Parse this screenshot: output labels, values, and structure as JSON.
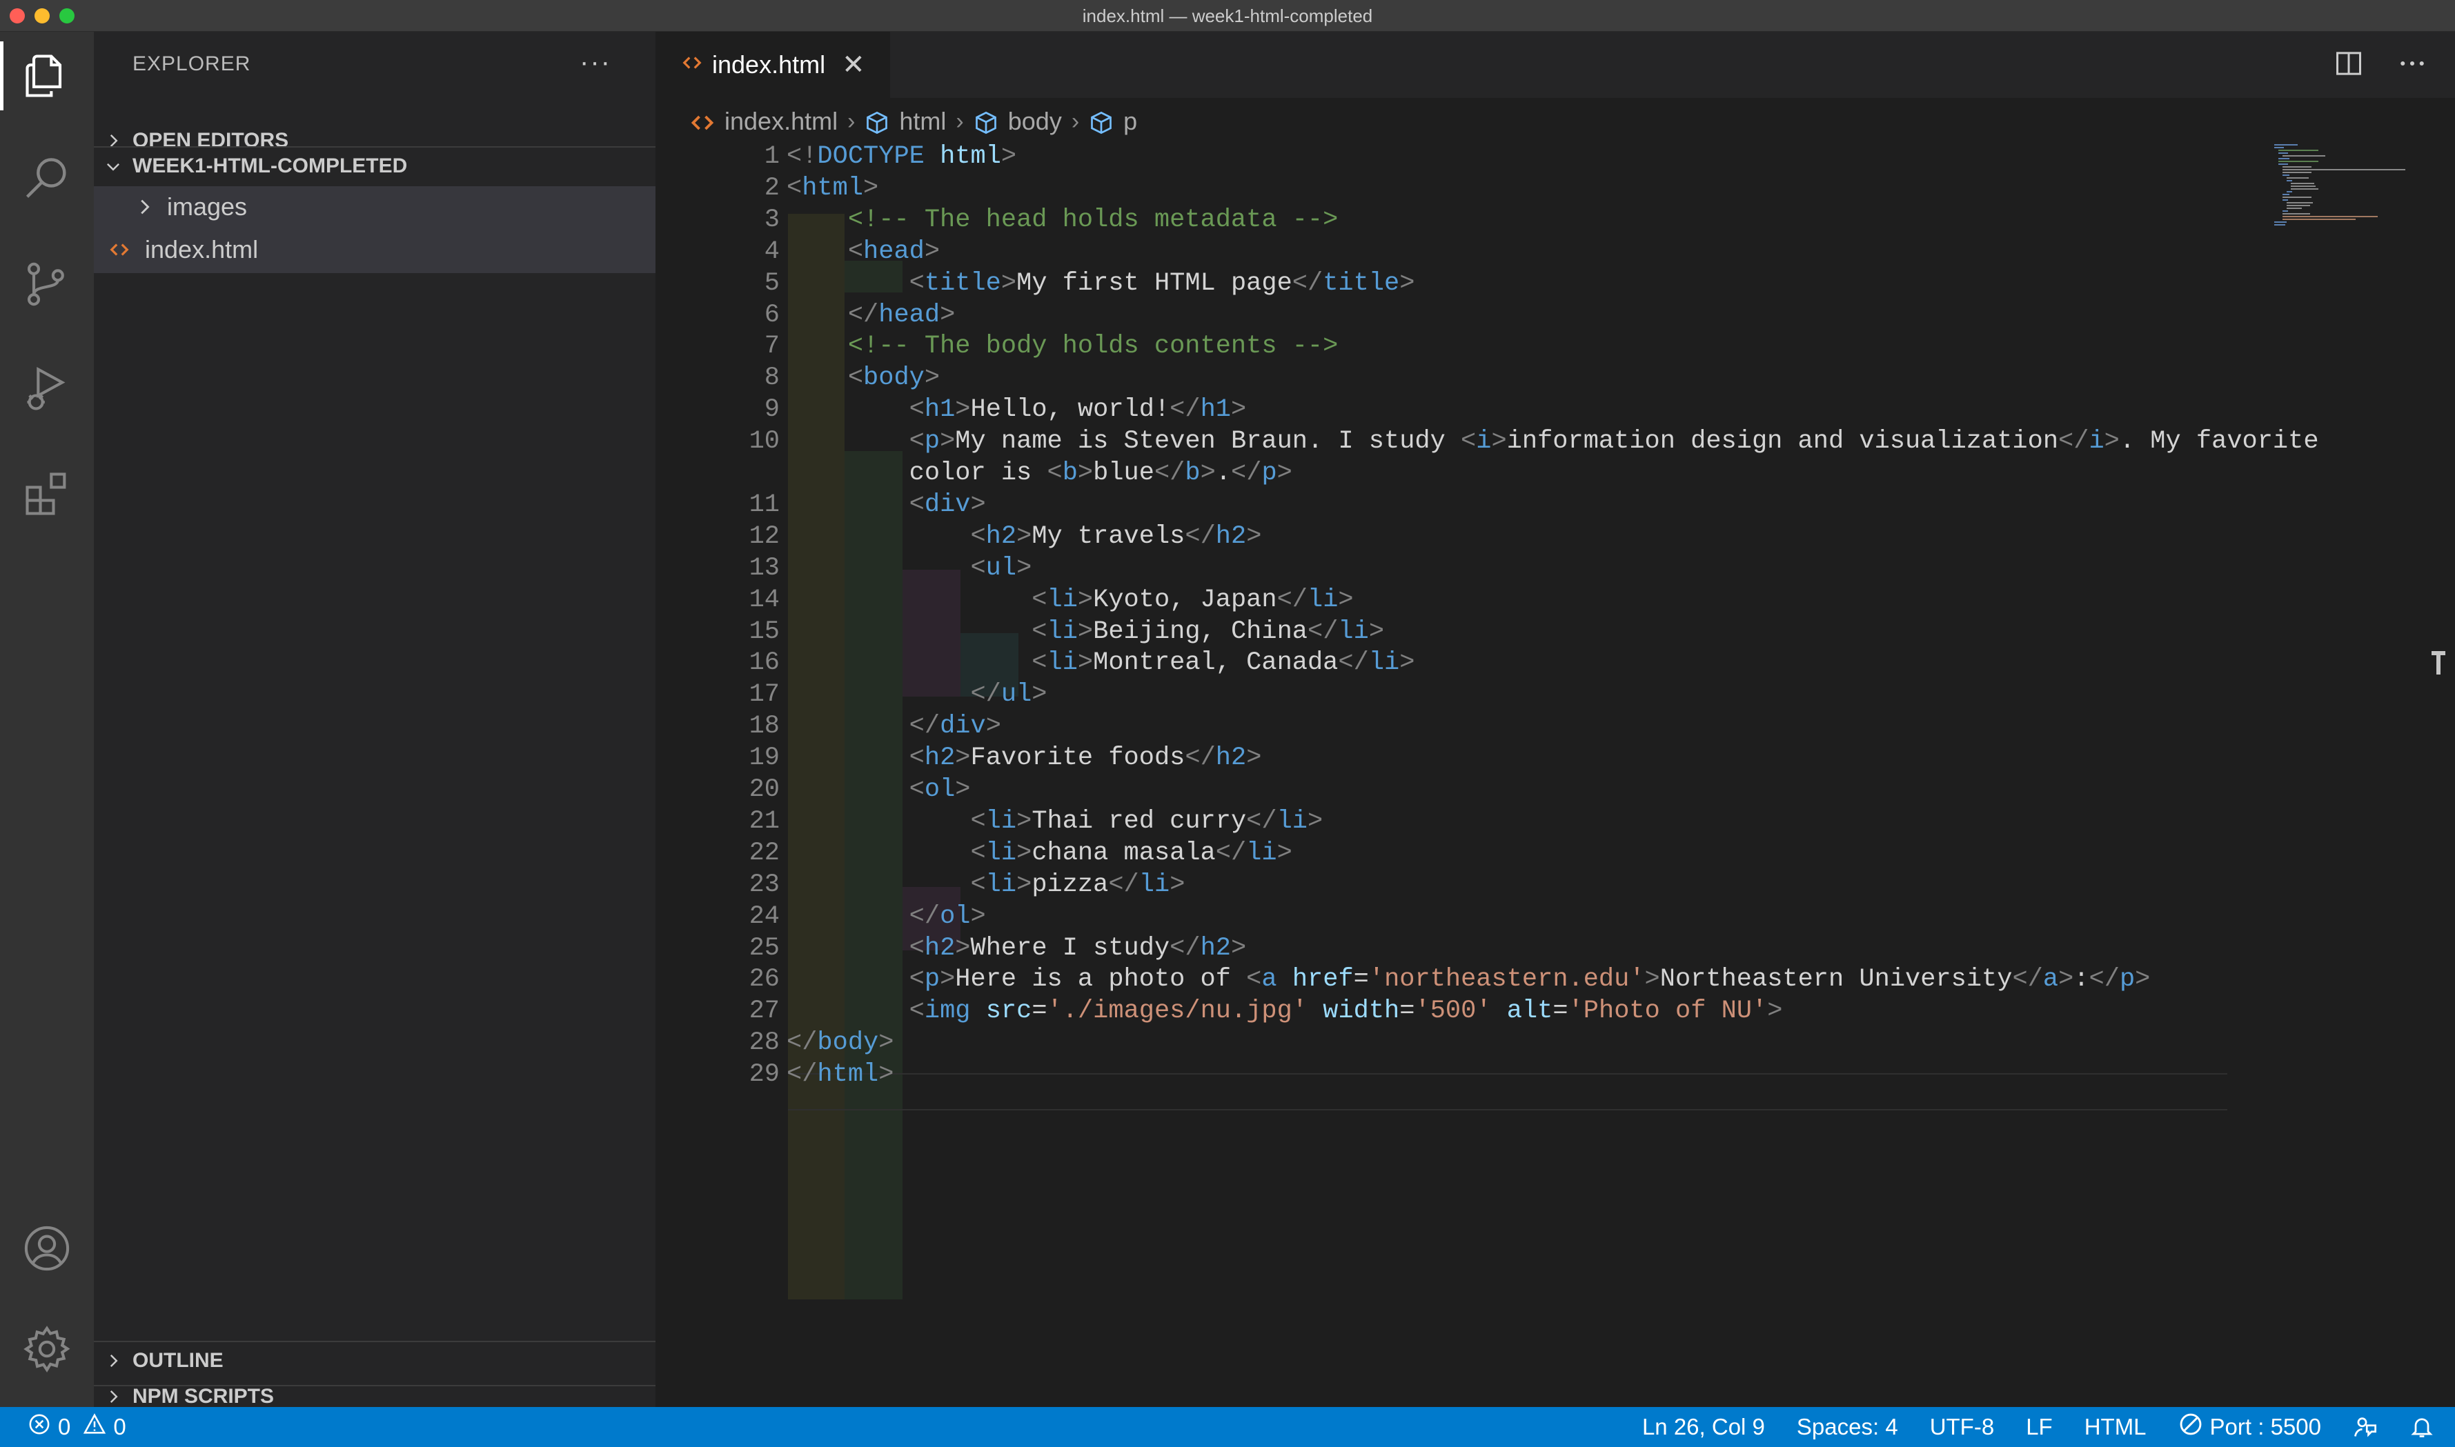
{
  "window": {
    "title": "index.html — week1-html-completed"
  },
  "activity_bar": {
    "items": [
      "explorer-icon",
      "search-icon",
      "source-control-icon",
      "run-debug-icon",
      "extensions-icon",
      "account-icon",
      "settings-gear-icon"
    ]
  },
  "sidebar": {
    "title": "EXPLORER",
    "more": "···",
    "sections": {
      "open_editors": "OPEN EDITORS",
      "workspace": "WEEK1-HTML-COMPLETED",
      "outline": "OUTLINE",
      "npm_scripts": "NPM SCRIPTS"
    },
    "tree": [
      {
        "label": "images",
        "type": "folder"
      },
      {
        "label": "index.html",
        "type": "file"
      }
    ]
  },
  "editor": {
    "tab": {
      "label": "index.html",
      "close": "✕"
    },
    "breadcrumbs": [
      "index.html",
      "html",
      "body",
      "p"
    ],
    "line_numbers": [
      "1",
      "2",
      "3",
      "4",
      "5",
      "6",
      "7",
      "8",
      "9",
      "10",
      "",
      "11",
      "12",
      "13",
      "14",
      "15",
      "16",
      "17",
      "18",
      "19",
      "20",
      "21",
      "22",
      "23",
      "24",
      "25",
      "26",
      "27",
      "28",
      "29"
    ],
    "lines": [
      [
        [
          "p",
          "<!"
        ],
        [
          "t",
          "DOCTYPE"
        ],
        [
          "x",
          " "
        ],
        [
          "a",
          "html"
        ],
        [
          "p",
          ">"
        ]
      ],
      [
        [
          "p",
          "<"
        ],
        [
          "t",
          "html"
        ],
        [
          "p",
          ">"
        ]
      ],
      [
        [
          "x",
          "    "
        ],
        [
          "c",
          "<!-- The head holds metadata -->"
        ]
      ],
      [
        [
          "x",
          "    "
        ],
        [
          "p",
          "<"
        ],
        [
          "t",
          "head"
        ],
        [
          "p",
          ">"
        ]
      ],
      [
        [
          "x",
          "        "
        ],
        [
          "p",
          "<"
        ],
        [
          "t",
          "title"
        ],
        [
          "p",
          ">"
        ],
        [
          "x",
          "My first HTML page"
        ],
        [
          "p",
          "</"
        ],
        [
          "t",
          "title"
        ],
        [
          "p",
          ">"
        ]
      ],
      [
        [
          "x",
          "    "
        ],
        [
          "p",
          "</"
        ],
        [
          "t",
          "head"
        ],
        [
          "p",
          ">"
        ]
      ],
      [
        [
          "x",
          "    "
        ],
        [
          "c",
          "<!-- The body holds contents -->"
        ]
      ],
      [
        [
          "x",
          "    "
        ],
        [
          "p",
          "<"
        ],
        [
          "t",
          "body"
        ],
        [
          "p",
          ">"
        ]
      ],
      [
        [
          "x",
          "        "
        ],
        [
          "p",
          "<"
        ],
        [
          "t",
          "h1"
        ],
        [
          "p",
          ">"
        ],
        [
          "x",
          "Hello, world!"
        ],
        [
          "p",
          "</"
        ],
        [
          "t",
          "h1"
        ],
        [
          "p",
          ">"
        ]
      ],
      [
        [
          "x",
          "        "
        ],
        [
          "p",
          "<"
        ],
        [
          "t",
          "p"
        ],
        [
          "p",
          ">"
        ],
        [
          "x",
          "My name is Steven Braun. I study "
        ],
        [
          "p",
          "<"
        ],
        [
          "t",
          "i"
        ],
        [
          "p",
          ">"
        ],
        [
          "x",
          "information design and visualization"
        ],
        [
          "p",
          "</"
        ],
        [
          "t",
          "i"
        ],
        [
          "p",
          ">"
        ],
        [
          "x",
          ". My favorite"
        ]
      ],
      [
        [
          "x",
          "        color is "
        ],
        [
          "p",
          "<"
        ],
        [
          "t",
          "b"
        ],
        [
          "p",
          ">"
        ],
        [
          "x",
          "blue"
        ],
        [
          "p",
          "</"
        ],
        [
          "t",
          "b"
        ],
        [
          "p",
          ">"
        ],
        [
          "x",
          "."
        ],
        [
          "p",
          "</"
        ],
        [
          "t",
          "p"
        ],
        [
          "p",
          ">"
        ]
      ],
      [
        [
          "x",
          "        "
        ],
        [
          "p",
          "<"
        ],
        [
          "t",
          "div"
        ],
        [
          "p",
          ">"
        ]
      ],
      [
        [
          "x",
          "            "
        ],
        [
          "p",
          "<"
        ],
        [
          "t",
          "h2"
        ],
        [
          "p",
          ">"
        ],
        [
          "x",
          "My travels"
        ],
        [
          "p",
          "</"
        ],
        [
          "t",
          "h2"
        ],
        [
          "p",
          ">"
        ]
      ],
      [
        [
          "x",
          "            "
        ],
        [
          "p",
          "<"
        ],
        [
          "t",
          "ul"
        ],
        [
          "p",
          ">"
        ]
      ],
      [
        [
          "x",
          "                "
        ],
        [
          "p",
          "<"
        ],
        [
          "t",
          "li"
        ],
        [
          "p",
          ">"
        ],
        [
          "x",
          "Kyoto, Japan"
        ],
        [
          "p",
          "</"
        ],
        [
          "t",
          "li"
        ],
        [
          "p",
          ">"
        ]
      ],
      [
        [
          "x",
          "                "
        ],
        [
          "p",
          "<"
        ],
        [
          "t",
          "li"
        ],
        [
          "p",
          ">"
        ],
        [
          "x",
          "Beijing, China"
        ],
        [
          "p",
          "</"
        ],
        [
          "t",
          "li"
        ],
        [
          "p",
          ">"
        ]
      ],
      [
        [
          "x",
          "                "
        ],
        [
          "p",
          "<"
        ],
        [
          "t",
          "li"
        ],
        [
          "p",
          ">"
        ],
        [
          "x",
          "Montreal, Canada"
        ],
        [
          "p",
          "</"
        ],
        [
          "t",
          "li"
        ],
        [
          "p",
          ">"
        ]
      ],
      [
        [
          "x",
          "            "
        ],
        [
          "p",
          "</"
        ],
        [
          "t",
          "ul"
        ],
        [
          "p",
          ">"
        ]
      ],
      [
        [
          "x",
          "        "
        ],
        [
          "p",
          "</"
        ],
        [
          "t",
          "div"
        ],
        [
          "p",
          ">"
        ]
      ],
      [
        [
          "x",
          "        "
        ],
        [
          "p",
          "<"
        ],
        [
          "t",
          "h2"
        ],
        [
          "p",
          ">"
        ],
        [
          "x",
          "Favorite foods"
        ],
        [
          "p",
          "</"
        ],
        [
          "t",
          "h2"
        ],
        [
          "p",
          ">"
        ]
      ],
      [
        [
          "x",
          "        "
        ],
        [
          "p",
          "<"
        ],
        [
          "t",
          "ol"
        ],
        [
          "p",
          ">"
        ]
      ],
      [
        [
          "x",
          "            "
        ],
        [
          "p",
          "<"
        ],
        [
          "t",
          "li"
        ],
        [
          "p",
          ">"
        ],
        [
          "x",
          "Thai red curry"
        ],
        [
          "p",
          "</"
        ],
        [
          "t",
          "li"
        ],
        [
          "p",
          ">"
        ]
      ],
      [
        [
          "x",
          "            "
        ],
        [
          "p",
          "<"
        ],
        [
          "t",
          "li"
        ],
        [
          "p",
          ">"
        ],
        [
          "x",
          "chana masala"
        ],
        [
          "p",
          "</"
        ],
        [
          "t",
          "li"
        ],
        [
          "p",
          ">"
        ]
      ],
      [
        [
          "x",
          "            "
        ],
        [
          "p",
          "<"
        ],
        [
          "t",
          "li"
        ],
        [
          "p",
          ">"
        ],
        [
          "x",
          "pizza"
        ],
        [
          "p",
          "</"
        ],
        [
          "t",
          "li"
        ],
        [
          "p",
          ">"
        ]
      ],
      [
        [
          "x",
          "        "
        ],
        [
          "p",
          "</"
        ],
        [
          "t",
          "ol"
        ],
        [
          "p",
          ">"
        ]
      ],
      [
        [
          "x",
          "        "
        ],
        [
          "p",
          "<"
        ],
        [
          "t",
          "h2"
        ],
        [
          "p",
          ">"
        ],
        [
          "x",
          "Where I study"
        ],
        [
          "p",
          "</"
        ],
        [
          "t",
          "h2"
        ],
        [
          "p",
          ">"
        ]
      ],
      [
        [
          "x",
          "        "
        ],
        [
          "p",
          "<"
        ],
        [
          "t",
          "p"
        ],
        [
          "p",
          ">"
        ],
        [
          "x",
          "Here is a photo of "
        ],
        [
          "p",
          "<"
        ],
        [
          "t",
          "a"
        ],
        [
          "x",
          " "
        ],
        [
          "a",
          "href"
        ],
        [
          "x",
          "="
        ],
        [
          "s",
          "'northeastern.edu'"
        ],
        [
          "p",
          ">"
        ],
        [
          "x",
          "Northeastern University"
        ],
        [
          "p",
          "</"
        ],
        [
          "t",
          "a"
        ],
        [
          "p",
          ">"
        ],
        [
          "x",
          ":"
        ],
        [
          "p",
          "</"
        ],
        [
          "t",
          "p"
        ],
        [
          "p",
          ">"
        ]
      ],
      [
        [
          "x",
          "        "
        ],
        [
          "p",
          "<"
        ],
        [
          "t",
          "img"
        ],
        [
          "x",
          " "
        ],
        [
          "a",
          "src"
        ],
        [
          "x",
          "="
        ],
        [
          "s",
          "'./images/nu.jpg'"
        ],
        [
          "x",
          " "
        ],
        [
          "a",
          "width"
        ],
        [
          "x",
          "="
        ],
        [
          "s",
          "'500'"
        ],
        [
          "x",
          " "
        ],
        [
          "a",
          "alt"
        ],
        [
          "x",
          "="
        ],
        [
          "s",
          "'Photo of NU'"
        ],
        [
          "p",
          ">"
        ]
      ],
      [
        [
          "p",
          "</"
        ],
        [
          "t",
          "body"
        ],
        [
          "p",
          ">"
        ]
      ],
      [
        [
          "p",
          "</"
        ],
        [
          "t",
          "html"
        ],
        [
          "p",
          ">"
        ]
      ]
    ]
  },
  "status_bar": {
    "errors": "0",
    "warnings": "0",
    "cursor": "Ln 26, Col 9",
    "spaces": "Spaces: 4",
    "encoding": "UTF-8",
    "eol": "LF",
    "language": "HTML",
    "port": "Port : 5500"
  },
  "colors": {
    "status_bar": "#007acc",
    "tag": "#569cd6",
    "attribute": "#9cdcfe",
    "string": "#ce9178",
    "comment": "#6a9955"
  }
}
